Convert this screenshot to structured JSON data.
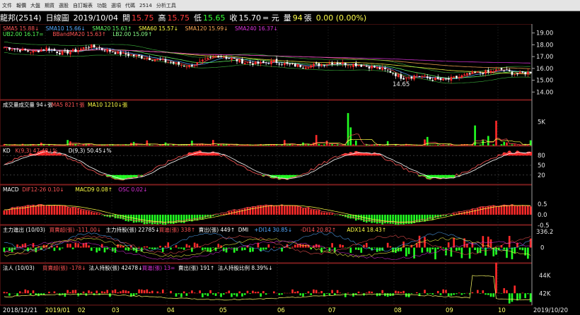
{
  "toolbar": {
    "items": [
      "文件",
      "報價",
      "大盤",
      "期貨",
      "選股",
      "自訂報表",
      "功能",
      "選項",
      "代碼",
      "2514",
      "分析工具"
    ]
  },
  "header": {
    "name": "龍邦(2514)",
    "period": "日線圖",
    "date": "2019/10/04",
    "open_label": "開",
    "open": "15.75",
    "high_label": "高",
    "high": "15.75",
    "low_label": "低",
    "low": "15.65",
    "close_label": "收",
    "close": "15.70",
    "close_unit": "= 元",
    "vol_label": "量",
    "vol": "94",
    "vol_unit": "張",
    "change": "0.00 (0.00%)"
  },
  "colors": {
    "up": "#ff2a2a",
    "down": "#22ff22",
    "sma5": "#ff5555",
    "sma10": "#55aaff",
    "sma20": "#66ff66",
    "sma60": "#ffff44",
    "sma120": "#ffaa55",
    "sma240": "#dd33dd"
  },
  "chart_data": [
    {
      "type": "line",
      "panel": "price",
      "legend": [
        {
          "text": "SMA5 15.88",
          "arrow": "↓",
          "color": "#ff5555"
        },
        {
          "text": "SMA10 15.66",
          "arrow": "↓",
          "color": "#55aaff"
        },
        {
          "text": "SMA20 15.63",
          "arrow": "↑",
          "color": "#66ff66"
        },
        {
          "text": "SMA60 15.57",
          "arrow": "↓",
          "color": "#ffff44"
        },
        {
          "text": "SMA120 15.99",
          "arrow": "↓",
          "color": "#ffaa55"
        },
        {
          "text": "SMA240 16.37",
          "arrow": "↓",
          "color": "#dd33dd"
        }
      ],
      "legend2": [
        {
          "text": "UB2.00 16.17",
          "arrow": "=",
          "color": "#55ff55"
        },
        {
          "text": "BBandMA20 15.63",
          "arrow": "↑",
          "color": "#ff5555"
        },
        {
          "text": "LB2.00 15.09",
          "arrow": "↑",
          "color": "#88ff88"
        }
      ],
      "y_ticks": [
        "19.00",
        "18.00",
        "17.00",
        "16.00",
        "15.00",
        "14.00"
      ],
      "ylim": [
        13.6,
        19.4
      ],
      "x_months": [
        "2018/12/21",
        "2019/01",
        "02",
        "03",
        "04",
        "05",
        "06",
        "07",
        "08",
        "09",
        "10",
        "2019/10/20"
      ],
      "min_label": "14.65",
      "close_anchor": [
        17.8,
        17.6,
        17.4,
        17.7,
        17.3,
        17.5,
        17.9,
        17.6,
        17.3,
        17.1,
        16.9,
        16.7,
        16.4,
        16.2,
        16.6,
        17.1,
        16.8,
        16.5,
        16.4,
        16.6,
        16.3,
        16.2,
        16.3,
        16.5,
        16.4,
        16.3,
        16.1,
        15.8,
        15.2,
        15.4,
        15.1,
        15.0,
        15.3,
        15.6,
        15.7,
        15.9,
        15.5,
        15.7
      ],
      "anchor_count": 38,
      "candles": 200
    },
    {
      "type": "bar",
      "panel": "volume",
      "legend": [
        {
          "text": "成交量",
          "color": "#ffffff"
        },
        {
          "text": "成交量 94",
          "arrow": "↓",
          "color": "#ffffff",
          "unit": "張"
        },
        {
          "text": "MA5 821",
          "arrow": "↑",
          "color": "#ff5555",
          "unit": "張"
        },
        {
          "text": "MA10 1210",
          "arrow": "↓",
          "color": "#ffff44",
          "unit": "張"
        }
      ],
      "y_ticks": [
        "5K"
      ],
      "ylim": [
        0,
        8000
      ]
    },
    {
      "type": "line",
      "panel": "kd",
      "legend": [
        {
          "text": "KD",
          "color": "#ffffff"
        },
        {
          "text": "K(9,3) 47.48",
          "arrow": "↓",
          "color": "#ff5555",
          "unit": "%"
        },
        {
          "text": "D(9,3) 50.45",
          "arrow": "↓",
          "color": "#ffffff",
          "unit": "%"
        }
      ],
      "y_ticks": [
        "80",
        "50",
        "20"
      ],
      "ylim": [
        0,
        100
      ]
    },
    {
      "type": "bar",
      "panel": "macd",
      "legend": [
        {
          "text": "MACD",
          "color": "#ffffff"
        },
        {
          "text": "DIF12-26 0.10",
          "arrow": "↓",
          "color": "#ff5555"
        },
        {
          "text": "MACD9 0.08",
          "arrow": "↑",
          "color": "#ffff44"
        },
        {
          "text": "OSC 0.02",
          "arrow": "↓",
          "color": "#dd33dd"
        }
      ],
      "y_ticks": [
        "0.5",
        "0.0",
        "-0.5"
      ],
      "ylim": [
        -0.8,
        0.8
      ]
    },
    {
      "type": "bar",
      "panel": "main_force",
      "legend": [
        {
          "text": "主力進出 (10/03)",
          "color": "#ffffff"
        },
        {
          "text": "買賣超(張) -111.00",
          "arrow": "↓",
          "color": "#ff5555"
        },
        {
          "text": "主力持股(張) 22785",
          "arrow": "↓",
          "color": "#ffffff"
        },
        {
          "text": "買進(張) 338",
          "arrow": "↑",
          "color": "#ff5555"
        },
        {
          "text": "賣出(張) 449",
          "arrow": "↑",
          "color": "#ffffff"
        },
        {
          "text": "DMI",
          "color": "#ffffff"
        },
        {
          "text": "+DI14 30.85",
          "arrow": "↓",
          "color": "#55aaff"
        },
        {
          "text": "-DI14 20.82",
          "arrow": "↑",
          "color": "#ff5555"
        },
        {
          "text": "ADX14 18.43",
          "arrow": "↑",
          "color": "#ffff44"
        }
      ],
      "y_ticks": [
        "336.2",
        "0"
      ],
      "ylim": [
        -600,
        600
      ]
    },
    {
      "type": "bar",
      "panel": "institutional",
      "legend": [
        {
          "text": "法人 (10/03)",
          "color": "#ffffff"
        },
        {
          "text": "買賣超(張) -178",
          "arrow": "↓",
          "color": "#ff5555"
        },
        {
          "text": "法人持股(張) 42478",
          "arrow": "↓",
          "color": "#ffffff"
        },
        {
          "text": "買進(張) 13",
          "arrow": "=",
          "color": "#dd33dd"
        },
        {
          "text": "賣出(張) 191",
          "arrow": "↑",
          "color": "#ffffff"
        },
        {
          "text": "法人持股比例 8.39%",
          "arrow": "↓",
          "color": "#ffffff"
        }
      ],
      "y_ticks": [
        "44K",
        "42K"
      ],
      "ylim": [
        41000,
        45000
      ]
    }
  ]
}
